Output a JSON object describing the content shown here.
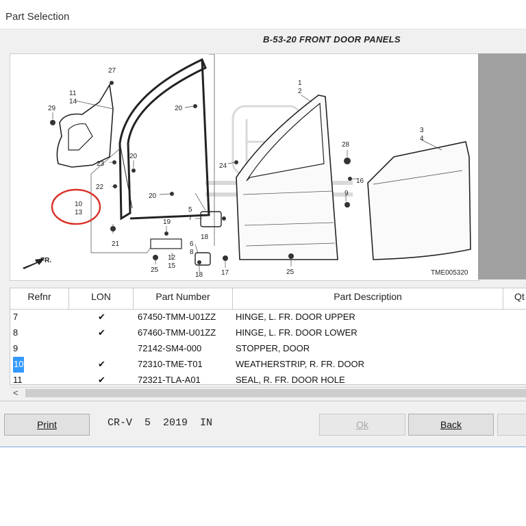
{
  "window": {
    "title": "Part Selection"
  },
  "diagram": {
    "title": "B-53-20 FRONT DOOR PANELS",
    "code": "TME005320",
    "direction_label": "FR.",
    "callouts": {
      "c27": "27",
      "c11": "11",
      "c14": "14",
      "c29": "29",
      "c20a": "20",
      "c20b": "20",
      "c20c": "20",
      "c23": "23",
      "c22": "22",
      "c10": "10",
      "c13": "13",
      "c21": "21",
      "c1": "1",
      "c2": "2",
      "c24": "24",
      "c28": "28",
      "c16": "16",
      "c9": "9",
      "c3": "3",
      "c4": "4",
      "c5": "5",
      "c7": "7",
      "c19": "19",
      "c6": "6",
      "c8": "8",
      "c18": "18",
      "c12": "12",
      "c15": "15",
      "c25a": "25",
      "c25b": "25",
      "c17": "17"
    }
  },
  "table": {
    "columns": [
      "Refnr",
      "LON",
      "Part Number",
      "Part Description",
      "Qt"
    ],
    "rows": [
      {
        "ref": "7",
        "lon": "✔",
        "part_number": "67450-TMM-U01ZZ",
        "description": "HINGE, L. FR. DOOR UPPER"
      },
      {
        "ref": "8",
        "lon": "✔",
        "part_number": "67460-TMM-U01ZZ",
        "description": "HINGE, L. FR. DOOR LOWER"
      },
      {
        "ref": "9",
        "lon": "",
        "part_number": "72142-SM4-000",
        "description": "STOPPER, DOOR"
      },
      {
        "ref": "10",
        "lon": "✔",
        "part_number": "72310-TME-T01",
        "description": "WEATHERSTRIP, R. FR. DOOR"
      },
      {
        "ref": "11",
        "lon": "✔",
        "part_number": "72321-TLA-A01",
        "description": "SEAL, R. FR. DOOR HOLE"
      }
    ],
    "selected_ref": "10",
    "scroll_left_glyph": "<"
  },
  "footer": {
    "print_label": "Print",
    "model_info": "CR-V  5  2019  IN",
    "ok_label": "Ok",
    "back_label": "Back"
  },
  "colors": {
    "selection": "#3399ff",
    "highlight_circle": "#d9342b",
    "window_border": "#7aa7d4"
  }
}
